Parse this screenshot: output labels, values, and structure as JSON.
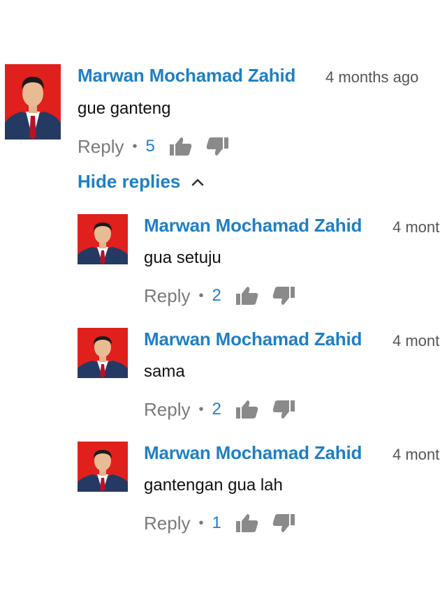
{
  "comments": [
    {
      "author": "Marwan Mochamad Zahid",
      "time": "4 months ago",
      "text": "gue ganteng",
      "reply_label": "Reply",
      "separator": "•",
      "likes": "5"
    }
  ],
  "hide_replies_label": "Hide replies",
  "replies": [
    {
      "author": "Marwan Mochamad Zahid",
      "time": "4 mont",
      "text": "gua setuju",
      "reply_label": "Reply",
      "separator": "•",
      "likes": "2"
    },
    {
      "author": "Marwan Mochamad Zahid",
      "time": "4 mont",
      "text": "sama",
      "reply_label": "Reply",
      "separator": "•",
      "likes": "2"
    },
    {
      "author": "Marwan Mochamad Zahid",
      "time": "4 mont",
      "text": "gantengan gua lah",
      "reply_label": "Reply",
      "separator": "•",
      "likes": "1"
    }
  ],
  "icons": {
    "like": "thumbs-up-icon",
    "dislike": "thumbs-down-icon",
    "collapse": "chevron-up-icon"
  },
  "colors": {
    "link_blue": "#1f7fc4",
    "meta_gray": "#7a7a7a",
    "icon_gray": "#8a8a8a",
    "avatar_red": "#e0201c"
  }
}
